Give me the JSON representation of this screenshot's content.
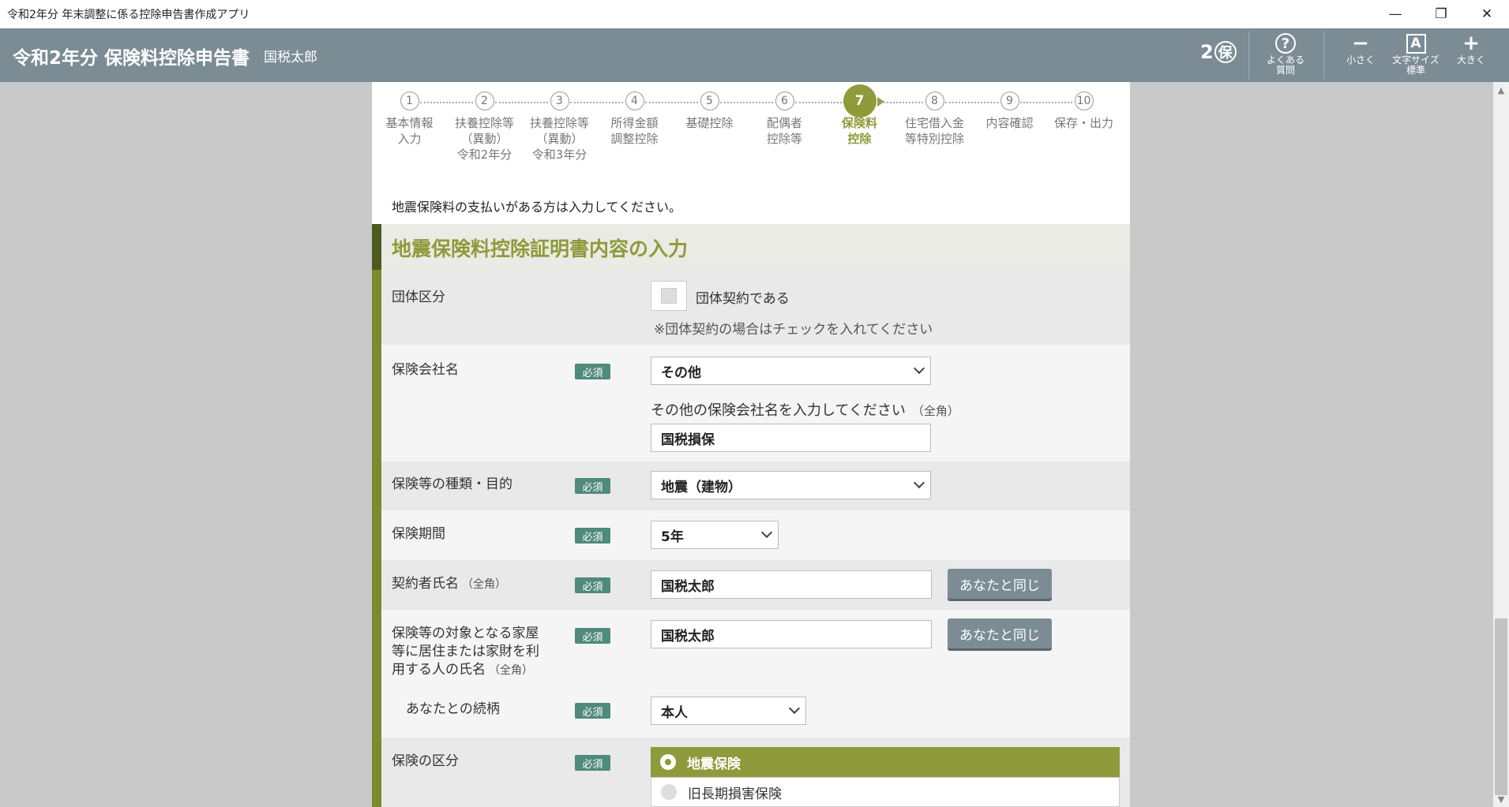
{
  "window": {
    "title": "令和2年分 年末調整に係る控除申告書作成アプリ",
    "minimize": "—",
    "restore": "❐",
    "close": "✕"
  },
  "header": {
    "title": "令和2年分 保険料控除申告書",
    "user": "国税太郎",
    "badge_num": "2",
    "badge_char": "保",
    "faq_label": "よくある\n質問",
    "smaller_label": "小さく",
    "fontsize_label": "文字サイズ\n標準",
    "fontsize_glyph": "A",
    "larger_label": "大きく"
  },
  "steps": [
    {
      "num": "1",
      "label": "基本情報\n入力"
    },
    {
      "num": "2",
      "label": "扶養控除等\n（異動）\n令和2年分"
    },
    {
      "num": "3",
      "label": "扶養控除等\n（異動）\n令和3年分"
    },
    {
      "num": "4",
      "label": "所得金額\n調整控除"
    },
    {
      "num": "5",
      "label": "基礎控除"
    },
    {
      "num": "6",
      "label": "配偶者\n控除等"
    },
    {
      "num": "7",
      "label": "保険料\n控除",
      "active": true
    },
    {
      "num": "8",
      "label": "住宅借入金\n等特別控除"
    },
    {
      "num": "9",
      "label": "内容確認"
    },
    {
      "num": "10",
      "label": "保存・出力"
    }
  ],
  "intro": "地震保険料の支払いがある方は入力してください。",
  "section": {
    "heading": "地震保険料控除証明書内容の入力",
    "required": "必須",
    "group": {
      "label": "団体区分",
      "checkbox_text": "団体契約である",
      "note": "※団体契約の場合はチェックを入れてください"
    },
    "company": {
      "label": "保険会社名",
      "selected": "その他",
      "other_prompt": "その他の保険会社名を入力してください",
      "other_hint": "（全角）",
      "other_value": "国税損保"
    },
    "type": {
      "label": "保険等の種類・目的",
      "selected": "地震（建物）"
    },
    "period": {
      "label": "保険期間",
      "selected": "5年"
    },
    "contractor": {
      "label": "契約者氏名",
      "hint": "（全角）",
      "value": "国税太郎",
      "same_button": "あなたと同じ"
    },
    "resident": {
      "label": "保険等の対象となる家屋\n等に居住または家財を利\n用する人の氏名",
      "hint": "（全角）",
      "value": "国税太郎",
      "same_button": "あなたと同じ"
    },
    "relation": {
      "label": "あなたとの続柄",
      "selected": "本人"
    },
    "category": {
      "label": "保険の区分",
      "options": [
        "地震保険",
        "旧長期損害保険"
      ],
      "selected_index": 0
    }
  }
}
